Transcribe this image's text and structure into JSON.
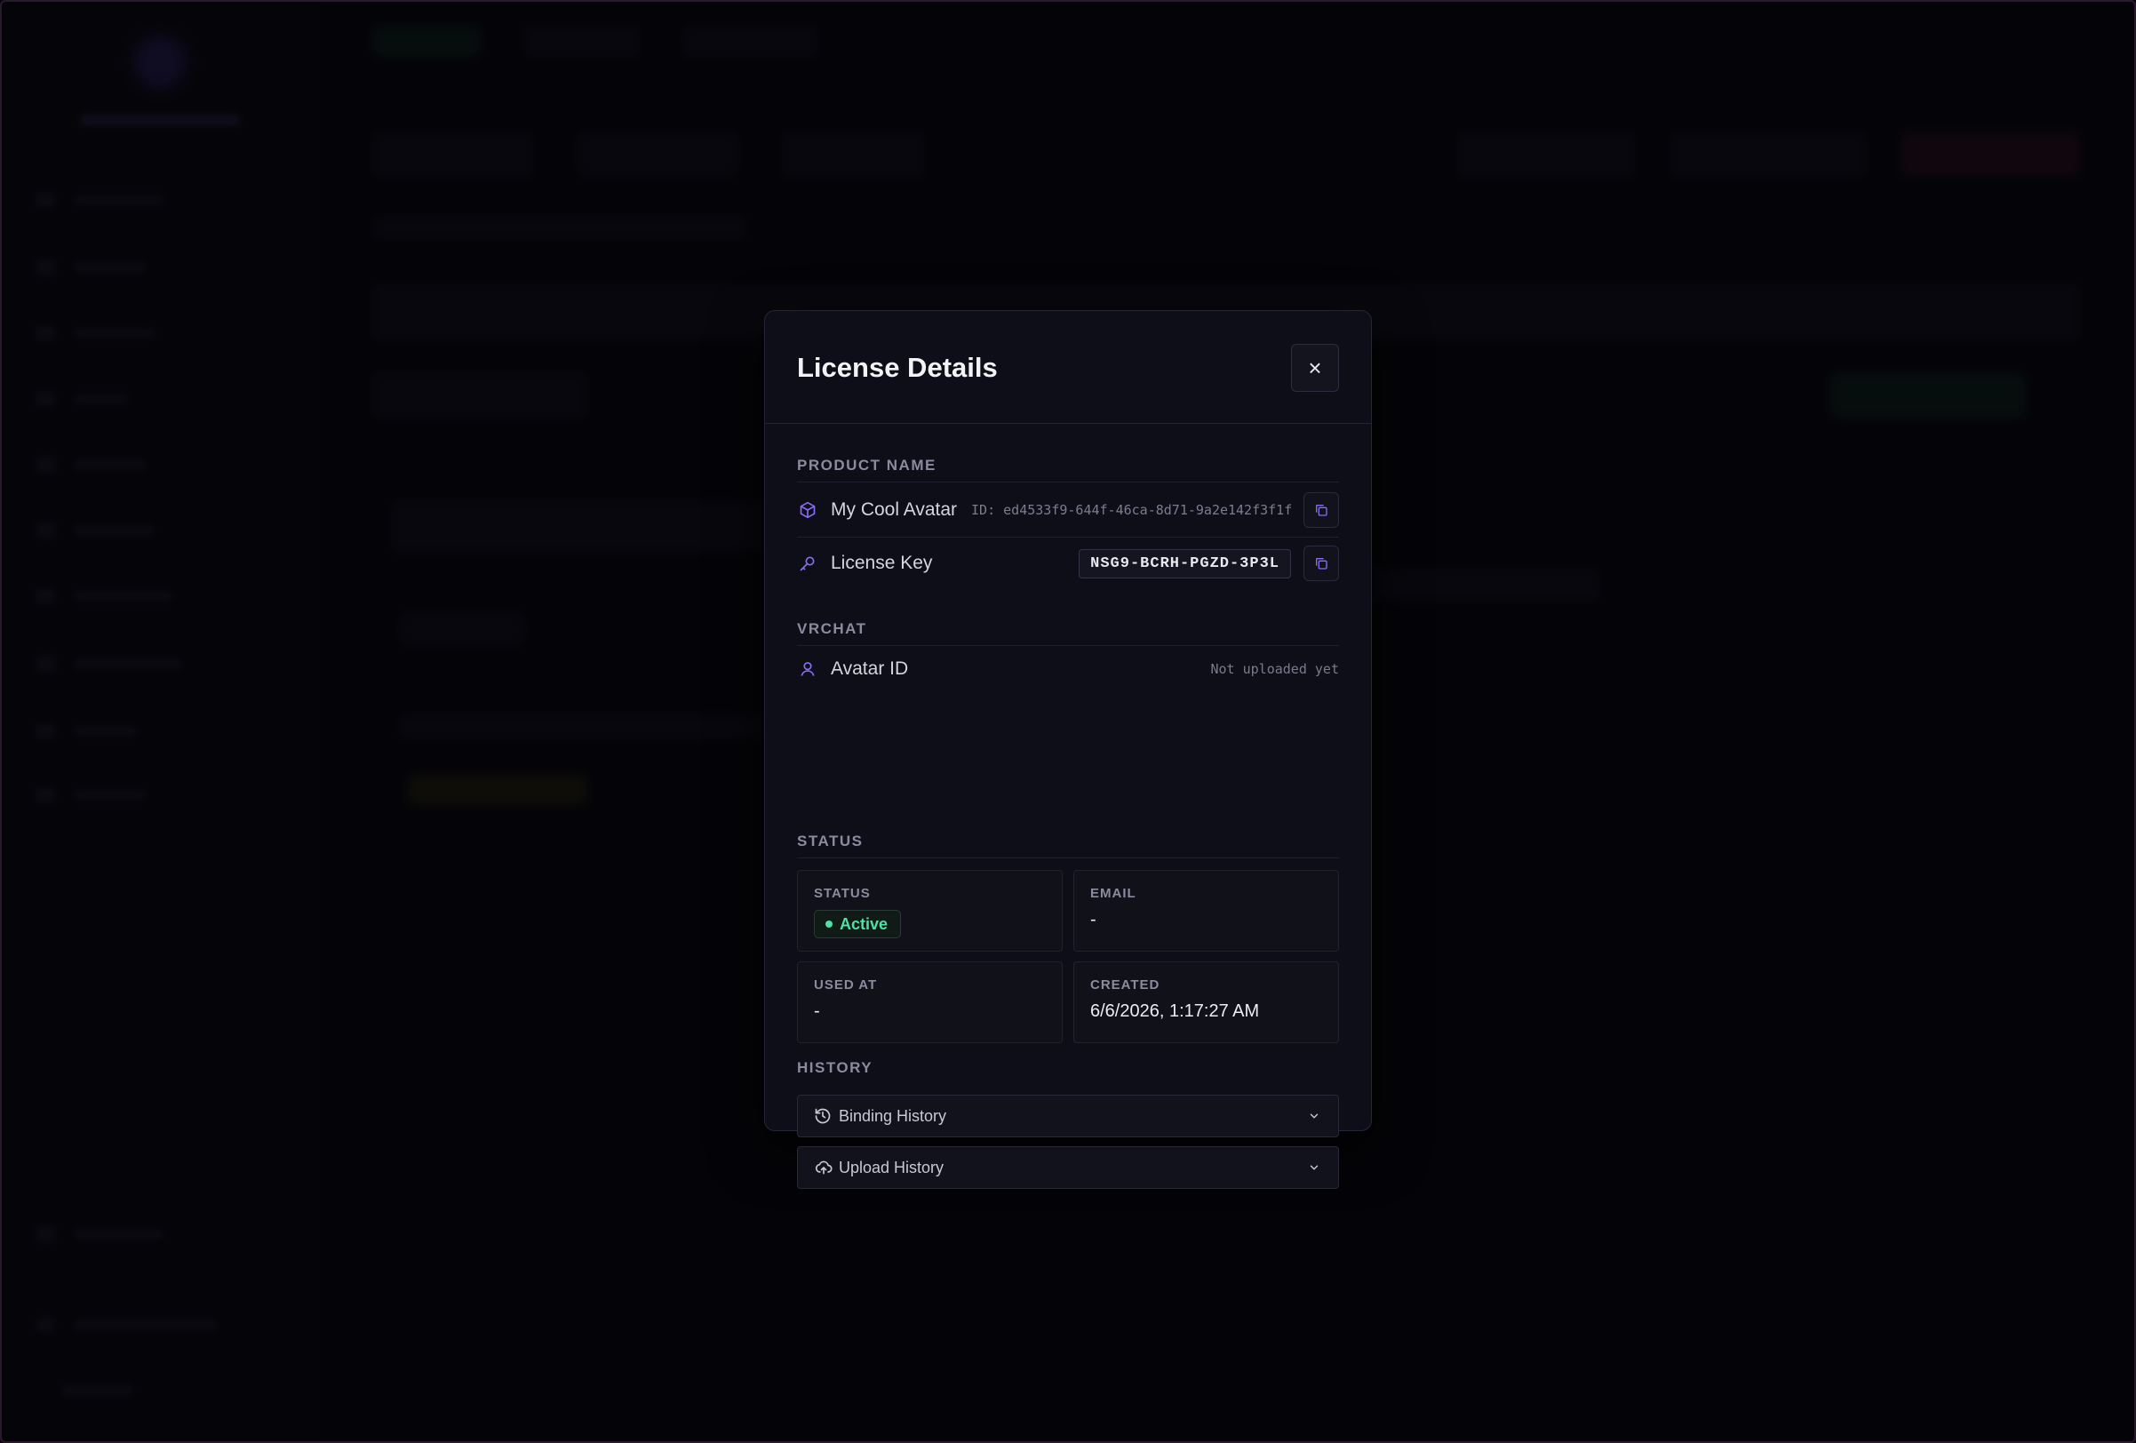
{
  "modal": {
    "title": "License Details",
    "close_icon": "×",
    "product_section": "PRODUCT NAME",
    "product_name": "My Cool Avatar",
    "product_id": "ID: ed4533f9-644f-46ca-8d71-9a2e142f3f1f",
    "license_key_label": "License Key",
    "license_key": "NSG9-BCRH-PGZD-3P3L",
    "vrchat_section": "VRCHAT",
    "avatar_id_label": "Avatar ID",
    "avatar_id_value": "Not uploaded yet",
    "status_section": "STATUS",
    "cards": {
      "status_label": "STATUS",
      "status_value": "Active",
      "email_label": "EMAIL",
      "email_value": "-",
      "used_at_label": "USED AT",
      "used_at_value": "-",
      "created_label": "CREATED",
      "created_value": "6/6/2026, 1:17:27 AM"
    },
    "history_section": "HISTORY",
    "binding_history": "Binding History",
    "upload_history": "Upload History"
  },
  "icons": {
    "product": "package-icon",
    "license_key": "key-icon",
    "avatar": "user-icon",
    "copy": "copy-icon",
    "binding": "history-icon",
    "upload": "cloud-upload-icon",
    "chevron": "chevron-down-icon",
    "close": "close-icon"
  },
  "colors": {
    "accent": "#8b6cf6",
    "active_green": "#4ee0a5",
    "modal_bg": "#0e0e19"
  }
}
